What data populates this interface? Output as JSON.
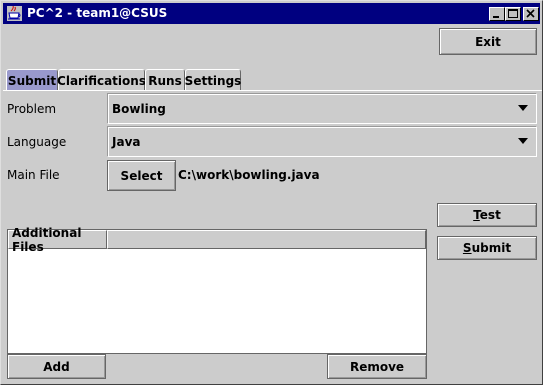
{
  "window": {
    "title": "PC^2 - team1@CSUS"
  },
  "toolbar": {
    "exit_label": "Exit"
  },
  "tabs": [
    {
      "label": "Submit",
      "active": true
    },
    {
      "label": "Clarifications",
      "active": false
    },
    {
      "label": "Runs",
      "active": false
    },
    {
      "label": "Settings",
      "active": false
    }
  ],
  "form": {
    "problem_label": "Problem",
    "problem_value": "Bowling",
    "language_label": "Language",
    "language_value": "Java",
    "main_file_label": "Main File",
    "select_label": "Select",
    "main_file_path": "C:\\work\\bowling.java"
  },
  "actions": {
    "test_label_rest": "est",
    "test_mnemonic": "T",
    "submit_label_rest": "ubmit",
    "submit_mnemonic": "S"
  },
  "files_table": {
    "columns": [
      "Additional Files",
      ""
    ],
    "rows": []
  },
  "files_actions": {
    "add_label": "Add",
    "remove_label": "Remove"
  },
  "colors": {
    "title_bar": "#000080",
    "active_tab": "#9999cc",
    "panel": "#cccccc"
  }
}
